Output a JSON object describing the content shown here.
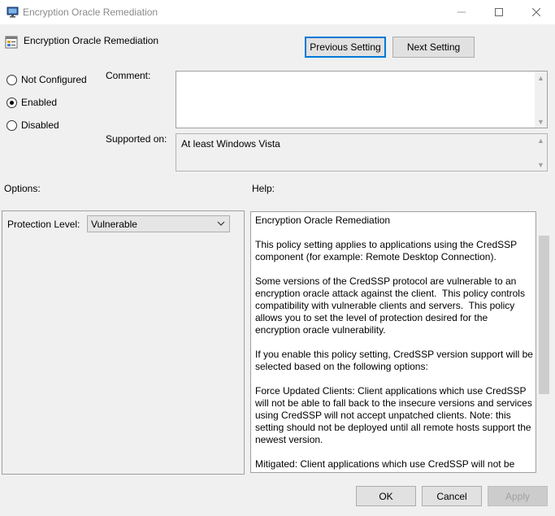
{
  "window": {
    "title": "Encryption Oracle Remediation"
  },
  "header": {
    "policy_name": "Encryption Oracle Remediation",
    "previous_label": "Previous Setting",
    "next_label": "Next Setting"
  },
  "state": {
    "options": [
      {
        "label": "Not Configured",
        "checked": false
      },
      {
        "label": "Enabled",
        "checked": true
      },
      {
        "label": "Disabled",
        "checked": false
      }
    ]
  },
  "comment": {
    "label": "Comment:",
    "value": ""
  },
  "supported": {
    "label": "Supported on:",
    "value": "At least Windows Vista"
  },
  "options_section": {
    "label": "Options:",
    "protection_label": "Protection Level:",
    "protection_value": "Vulnerable"
  },
  "help_section": {
    "label": "Help:",
    "paragraphs": [
      "Encryption Oracle Remediation",
      "This policy setting applies to applications using the CredSSP component (for example: Remote Desktop Connection).",
      "Some versions of the CredSSP protocol are vulnerable to an encryption oracle attack against the client.  This policy controls compatibility with vulnerable clients and servers.  This policy allows you to set the level of protection desired for the encryption oracle vulnerability.",
      "If you enable this policy setting, CredSSP version support will be selected based on the following options:",
      "Force Updated Clients: Client applications which use CredSSP will not be able to fall back to the insecure versions and services using CredSSP will not accept unpatched clients. Note: this setting should not be deployed until all remote hosts support the newest version.",
      "Mitigated: Client applications which use CredSSP will not be able"
    ]
  },
  "footer": {
    "ok_label": "OK",
    "cancel_label": "Cancel",
    "apply_label": "Apply"
  },
  "icons": {
    "app": "monitor-icon",
    "policy": "policy-setting-icon"
  },
  "colors": {
    "default_button_border": "#0078d7",
    "background": "#f0f0f0"
  }
}
